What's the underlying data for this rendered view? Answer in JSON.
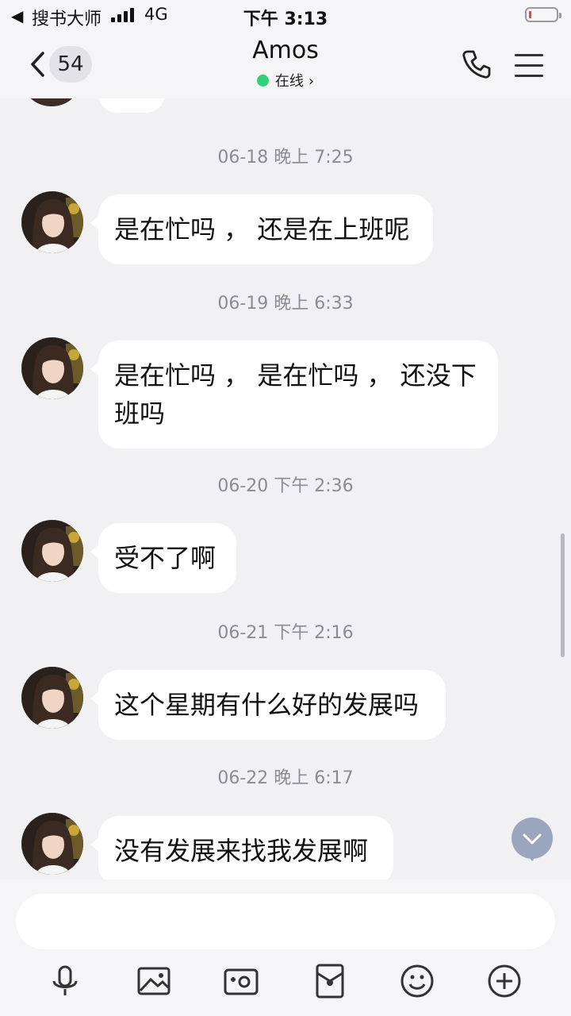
{
  "status_bar": {
    "back_glyph": "◀",
    "back_app": "搜书大师",
    "network": "4G",
    "time": "下午 3:13",
    "battery_level": 0.1,
    "battery_color": "#e8463a"
  },
  "header": {
    "unread_count": "54",
    "title": "Amos",
    "presence": "在线",
    "presence_color": "#2fd27a"
  },
  "messages": [
    {
      "timestamp": "06-18 晚上 7:25",
      "lines": [
        "是在忙吗 ， 还是在上班呢"
      ]
    },
    {
      "timestamp": "06-19 晚上 6:33",
      "lines": [
        "是在忙吗 ， 是在忙吗 ， 还没下",
        "班吗"
      ]
    },
    {
      "timestamp": "06-20 下午 2:36",
      "lines": [
        "受不了啊"
      ]
    },
    {
      "timestamp": "06-21 下午 2:16",
      "lines": [
        "这个星期有什么好的发展吗"
      ]
    },
    {
      "timestamp": "06-22 晚上 6:17",
      "lines": [
        "没有发展来找我发展啊"
      ]
    }
  ],
  "input": {
    "placeholder": ""
  },
  "toolbar": {
    "icons": [
      "microphone-icon",
      "image-icon",
      "camera-icon",
      "red-packet-icon",
      "emoji-icon",
      "plus-icon"
    ]
  },
  "colors": {
    "background": "#f1f1f3",
    "bubble": "#ffffff",
    "timestamp": "#8b8b94",
    "scroll_button": "#9aa6bd"
  }
}
